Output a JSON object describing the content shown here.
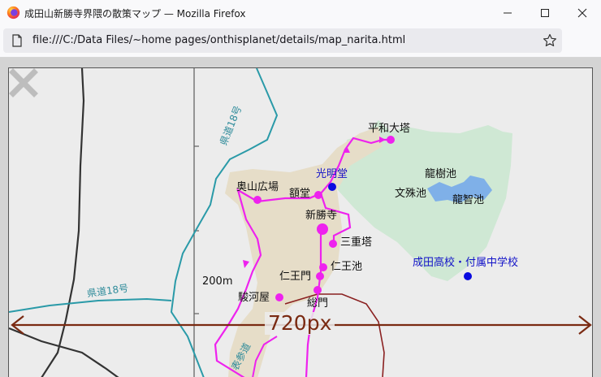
{
  "window": {
    "title": "成田山新勝寺界隈の散策マップ — Mozilla Firefox"
  },
  "toolbar": {
    "url": "file:///C:/Data Files/~home pages/onthisplanet/details/map_narita.html"
  },
  "icons": {
    "app": "firefox-icon",
    "minimize": "minimize-icon",
    "maximize": "maximize-icon",
    "close": "close-icon",
    "page": "page-icon",
    "bookmark": "star-icon",
    "menu": "hamburger-menu-icon",
    "map_close": "close-x-icon"
  },
  "map": {
    "labels": {
      "heiwa": "平和大塔",
      "komyodo": "光明堂",
      "ryujuchi": "龍樹池",
      "okuyama": "奥山広場",
      "gakudo": "額堂",
      "monjuchi": "文殊池",
      "ryuchichi": "龍智池",
      "shinshoji": "新勝寺",
      "sanjunoto": "三重塔",
      "school": "成田高校・付属中学校",
      "scale": "200m",
      "niomon": "仁王門",
      "niochi": "仁王池",
      "surugaya": "駿河屋",
      "somon": "総門",
      "road_upper": "県道18号",
      "road_lower": "県道18号",
      "omotesando": "表参道"
    },
    "width_label": "720px",
    "colors": {
      "route": "#ee22ee",
      "spot": "#ee22ee",
      "blue_spot": "#0a0ae0",
      "park": "#cfe8d4",
      "temple": "#e6ddc8",
      "pond": "#7fb0e8",
      "road_teal": "#2a9aa8",
      "arrow": "#7a2a12"
    }
  }
}
